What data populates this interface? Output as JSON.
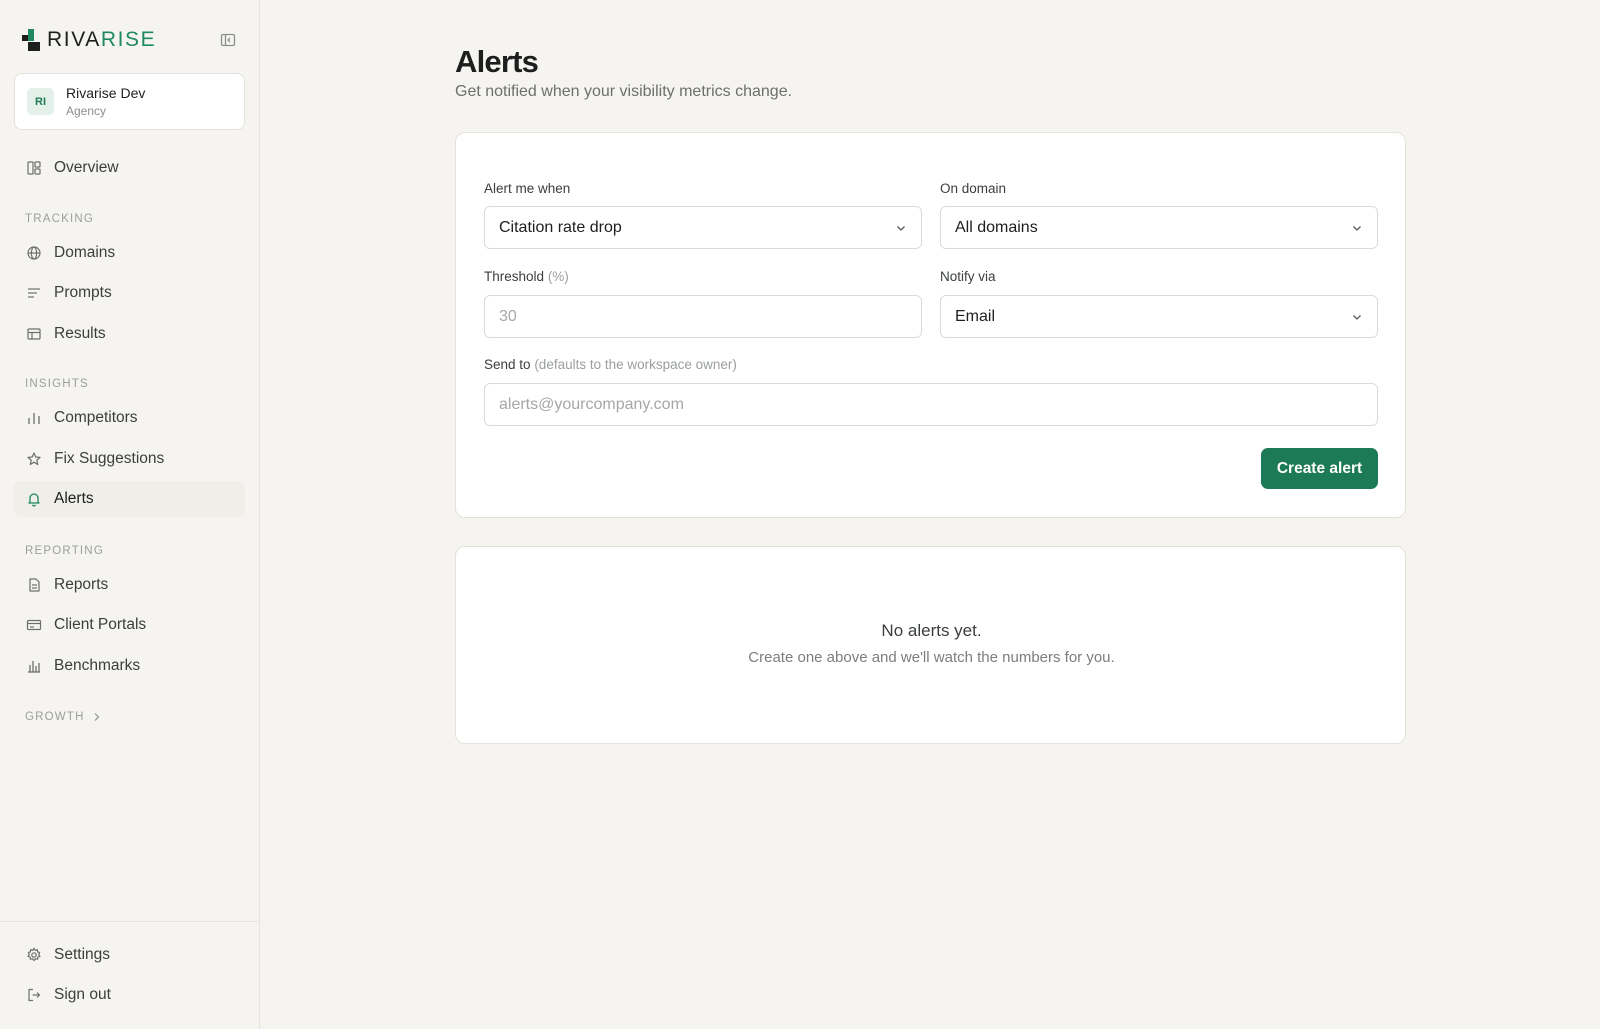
{
  "brand": {
    "name_prefix": "RIVA",
    "name_accent": "RISE",
    "accent_color": "#1f8a62"
  },
  "workspace": {
    "initials": "RI",
    "name": "Rivarise Dev",
    "type": "Agency"
  },
  "sidebar": {
    "overview": {
      "label": "Overview",
      "icon": "overview-grid-icon"
    },
    "sections": [
      {
        "label": "TRACKING",
        "items": [
          {
            "label": "Domains",
            "icon": "globe-icon"
          },
          {
            "label": "Prompts",
            "icon": "list-lines-icon"
          },
          {
            "label": "Results",
            "icon": "table-icon"
          }
        ]
      },
      {
        "label": "INSIGHTS",
        "items": [
          {
            "label": "Competitors",
            "icon": "bar-chart-icon"
          },
          {
            "label": "Fix Suggestions",
            "icon": "star-icon"
          },
          {
            "label": "Alerts",
            "icon": "bell-icon",
            "active": true
          }
        ]
      },
      {
        "label": "REPORTING",
        "items": [
          {
            "label": "Reports",
            "icon": "document-icon"
          },
          {
            "label": "Client Portals",
            "icon": "portal-card-icon"
          },
          {
            "label": "Benchmarks",
            "icon": "benchmark-chart-icon"
          }
        ]
      },
      {
        "label": "GROWTH",
        "collapsed": true
      }
    ],
    "footer": [
      {
        "label": "Settings",
        "icon": "gear-icon"
      },
      {
        "label": "Sign out",
        "icon": "sign-out-icon"
      }
    ]
  },
  "page": {
    "title": "Alerts",
    "subtitle": "Get notified when your visibility metrics change."
  },
  "form": {
    "alert_when": {
      "label": "Alert me when",
      "value": "Citation rate drop"
    },
    "domain": {
      "label": "On domain",
      "value": "All domains"
    },
    "threshold": {
      "label": "Threshold",
      "label_hint": "(%)",
      "placeholder": "30"
    },
    "notify": {
      "label": "Notify via",
      "value": "Email"
    },
    "send_to": {
      "label": "Send to",
      "label_hint": "(defaults to the workspace owner)",
      "placeholder": "alerts@yourcompany.com"
    },
    "submit_label": "Create alert"
  },
  "empty_state": {
    "title": "No alerts yet.",
    "subtitle": "Create one above and we'll watch the numbers for you."
  }
}
